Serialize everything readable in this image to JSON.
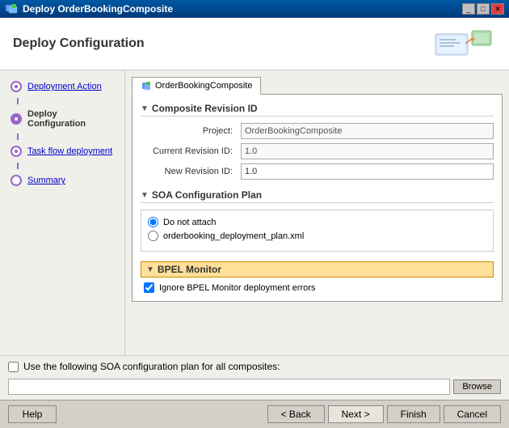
{
  "titlebar": {
    "title": "Deploy OrderBookingComposite",
    "close_label": "✕",
    "min_label": "_",
    "max_label": "□"
  },
  "header": {
    "title": "Deploy Configuration"
  },
  "sidebar": {
    "items": [
      {
        "id": "deployment-action",
        "label": "Deployment Action",
        "state": "visited"
      },
      {
        "id": "deploy-configuration",
        "label": "Deploy Configuration",
        "state": "active"
      },
      {
        "id": "task-flow-deployment",
        "label": "Task flow deployment",
        "state": "visited"
      },
      {
        "id": "summary",
        "label": "Summary",
        "state": "pending"
      }
    ]
  },
  "tab": {
    "label": "OrderBookingComposite",
    "icon": "composite-icon"
  },
  "composite_revision": {
    "section_title": "Composite Revision ID",
    "project_label": "Project:",
    "project_value": "OrderBookingComposite",
    "current_revision_label": "Current Revision ID:",
    "current_revision_value": "1.0",
    "new_revision_label": "New Revision ID:",
    "new_revision_value": "1.0"
  },
  "soa_config": {
    "section_title": "SOA Configuration Plan",
    "option1": "Do not attach",
    "option2": "orderbooking_deployment_plan.xml"
  },
  "bpel_monitor": {
    "section_title": "BPEL Monitor",
    "checkbox_label": "Ignore BPEL Monitor deployment errors",
    "checked": true
  },
  "bottom": {
    "soa_global_label": "Use the following SOA configuration plan for all composites:",
    "soa_global_placeholder": "",
    "browse_label": "Browse"
  },
  "footer": {
    "help_label": "Help",
    "back_label": "< Back",
    "next_label": "Next >",
    "finish_label": "Finish",
    "cancel_label": "Cancel"
  }
}
